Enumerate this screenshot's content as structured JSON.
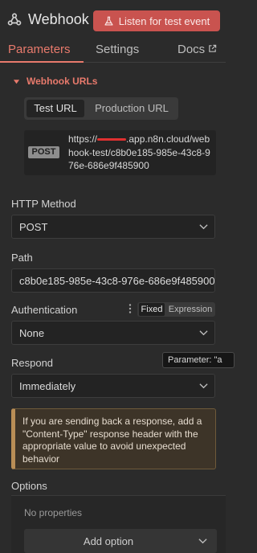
{
  "header": {
    "node_icon": "webhook-icon",
    "title": "Webhook",
    "listen_button": "Listen for test event",
    "listen_icon": "flask-icon",
    "accent_color": "#c9534f"
  },
  "tabs": [
    {
      "label": "Parameters",
      "active": true
    },
    {
      "label": "Settings",
      "active": false
    },
    {
      "label": "Docs",
      "active": false,
      "icon": "external-link-icon"
    }
  ],
  "webhook_urls": {
    "title": "Webhook URLs",
    "toggle": [
      "Test URL",
      "Production URL"
    ],
    "selected": "Test URL",
    "method_badge": "POST",
    "url_prefix": "https://",
    "url_rest": ".app.n8n.cloud/webhook-test/c8b0e185-985e-43c8-976e-686e9f485900"
  },
  "http_method": {
    "label": "HTTP Method",
    "value": "POST"
  },
  "path": {
    "label": "Path",
    "value": "c8b0e185-985e-43c8-976e-686e9f485900"
  },
  "authentication": {
    "label": "Authentication",
    "value": "None",
    "mode_options": [
      "Fixed",
      "Expression"
    ],
    "mode_selected": "Fixed"
  },
  "respond": {
    "label": "Respond",
    "value": "Immediately"
  },
  "tooltip": {
    "text": "Parameter: \"a"
  },
  "notice": {
    "text": "If you are sending back a response, add a \"Content-Type\" response header with the appropriate value to avoid unexpected behavior"
  },
  "options": {
    "label": "Options",
    "empty_text": "No properties",
    "add_button": "Add option"
  }
}
